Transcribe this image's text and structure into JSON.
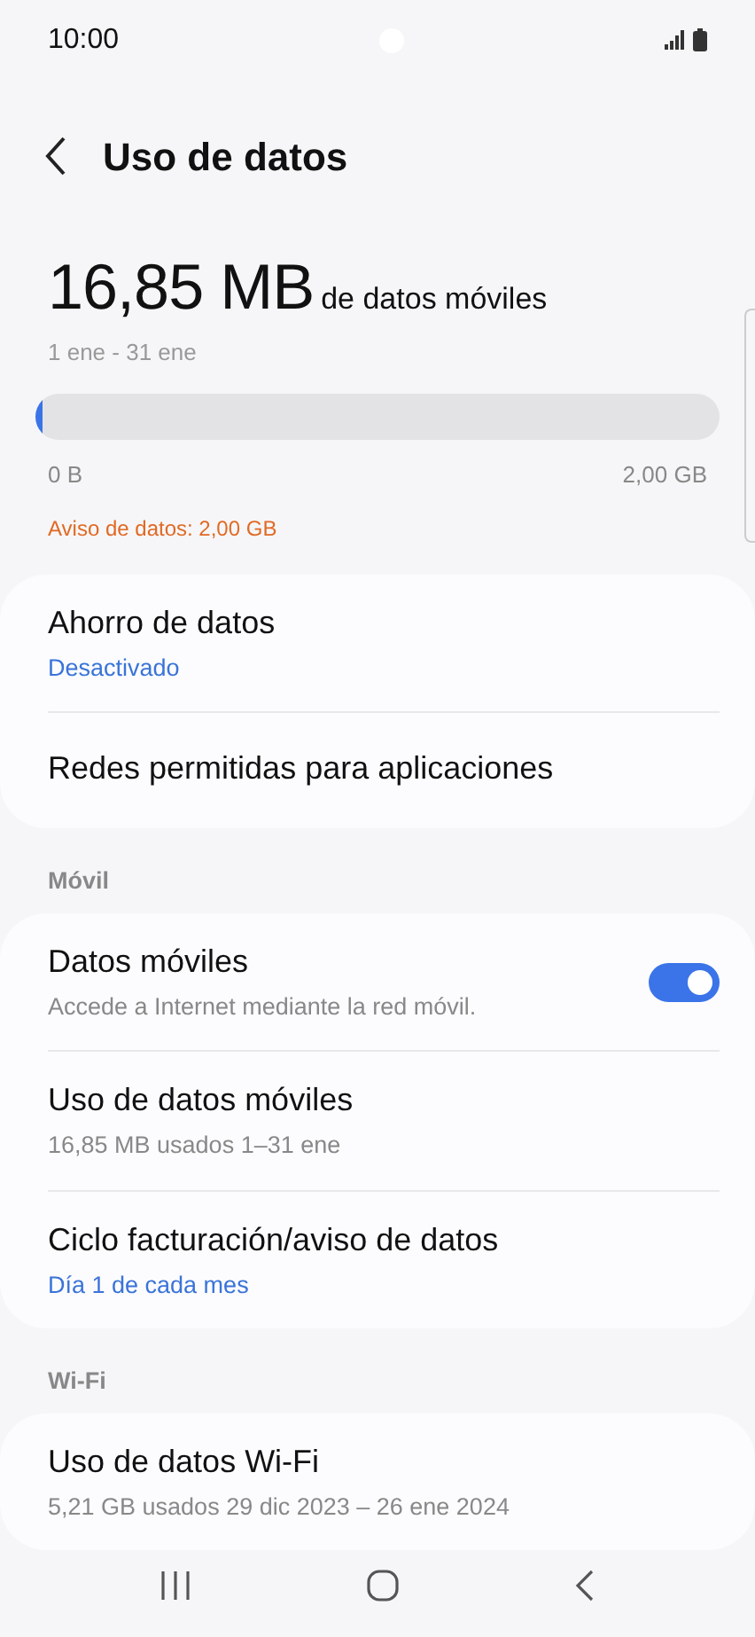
{
  "status_bar": {
    "time": "10:00"
  },
  "header": {
    "title": "Uso de datos"
  },
  "usage": {
    "amount": "16,85 MB",
    "unit_label": "de datos móviles",
    "period": "1 ene - 31 ene",
    "level": 0.01,
    "min_label": "0 B",
    "max_label": "2,00 GB",
    "warning": "Aviso de datos: 2,00 GB"
  },
  "sections": [
    {
      "items": [
        {
          "title": "Ahorro de datos",
          "subtitle": "Desactivado",
          "kind": "value"
        },
        {
          "title": "Redes permitidas para aplicaciones",
          "kind": "plain"
        }
      ]
    },
    {
      "header": "Móvil",
      "items": [
        {
          "title": "Datos móviles",
          "subtitle": "Accede a Internet mediante la red móvil.",
          "kind": "switch",
          "on": true
        },
        {
          "title": "Uso de datos móviles",
          "subtitle": "16,85 MB usados 1–31 ene",
          "kind": "summary"
        },
        {
          "title": "Ciclo facturación/aviso de datos",
          "subtitle": "Día 1 de cada mes",
          "kind": "value"
        }
      ]
    },
    {
      "header": "Wi-Fi",
      "items": [
        {
          "title": "Uso de datos Wi-Fi",
          "subtitle": "5,21 GB usados 29 dic 2023 – 26 ene 2024",
          "kind": "summary"
        }
      ]
    }
  ]
}
